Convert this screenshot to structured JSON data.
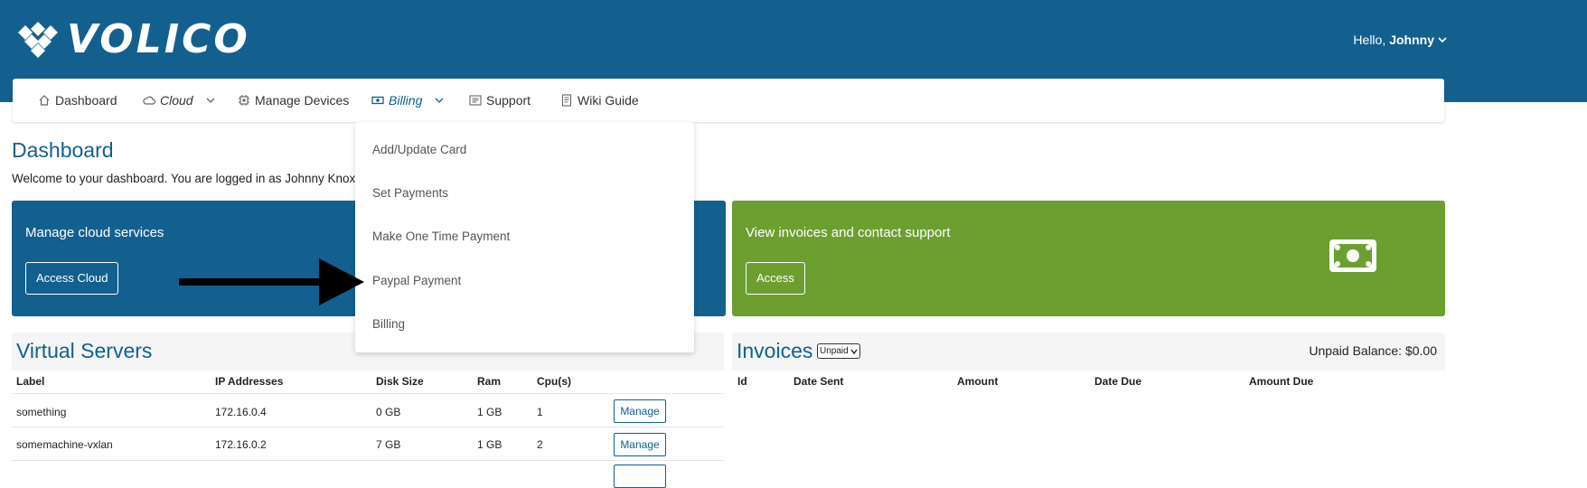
{
  "brand": {
    "name": "VOLICO"
  },
  "user": {
    "greeting": "Hello,",
    "name": "Johnny"
  },
  "nav": {
    "items": [
      {
        "label": "Dashboard",
        "icon": "home-icon"
      },
      {
        "label": "Cloud",
        "icon": "cloud-icon"
      },
      {
        "label": "Manage Devices",
        "icon": "chip-icon"
      },
      {
        "label": "Billing",
        "icon": "cash-icon"
      },
      {
        "label": "Support",
        "icon": "support-icon"
      },
      {
        "label": "Wiki Guide",
        "icon": "book-icon"
      }
    ]
  },
  "billing_menu": {
    "items": [
      "Add/Update Card",
      "Set Payments",
      "Make One Time Payment",
      "Paypal Payment",
      "Billing"
    ]
  },
  "page": {
    "title": "Dashboard",
    "welcome": "Welcome to your dashboard. You are logged in as Johnny Knoxvill"
  },
  "cards": {
    "cloud": {
      "title": "Manage cloud services",
      "button": "Access Cloud"
    },
    "invoices": {
      "title": "View invoices and contact support",
      "button": "Access",
      "icon": "money-icon"
    }
  },
  "virtual_servers": {
    "title": "Virtual Servers",
    "columns": [
      "Label",
      "IP Addresses",
      "Disk Size",
      "Ram",
      "Cpu(s)"
    ],
    "rows": [
      {
        "label": "something",
        "ip": "172.16.0.4",
        "disk": "0 GB",
        "ram": "1 GB",
        "cpu": "1",
        "action": "Manage"
      },
      {
        "label": "somemachine-vxlan",
        "ip": "172.16.0.2",
        "disk": "7 GB",
        "ram": "1 GB",
        "cpu": "2",
        "action": "Manage"
      }
    ]
  },
  "invoices": {
    "title": "Invoices",
    "filter": "Unpaid",
    "balance": "Unpaid Balance: $0.00",
    "columns": [
      "Id",
      "Date Sent",
      "Amount",
      "Date Due",
      "Amount Due"
    ]
  },
  "colors": {
    "primary": "#13608f",
    "success": "#6c9f30"
  }
}
